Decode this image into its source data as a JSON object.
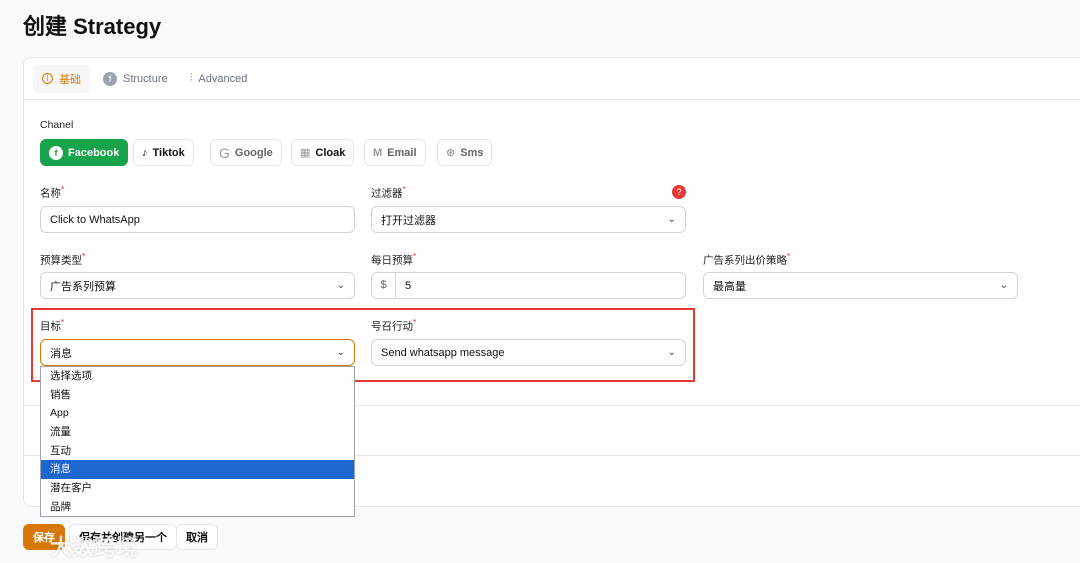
{
  "page_title": "创建 Strategy",
  "tabs": [
    {
      "label": "基础"
    },
    {
      "label": "Structure"
    },
    {
      "label": "Advanced"
    }
  ],
  "channel": {
    "label": "Chanel",
    "options": [
      "Facebook",
      "Tiktok",
      "Google",
      "Cloak",
      "Email",
      "Sms"
    ],
    "selected": "Facebook"
  },
  "form": {
    "name": {
      "label": "名称",
      "value": "Click to WhatsApp"
    },
    "filter": {
      "label": "过滤器",
      "value": "打开过滤器",
      "help": "?"
    },
    "budget_type": {
      "label": "预算类型",
      "value": "广告系列预算"
    },
    "daily_budget": {
      "label": "每日预算",
      "prefix": "$",
      "value": "5"
    },
    "bid_strategy": {
      "label": "广告系列出价策略",
      "value": "最高量"
    },
    "objective": {
      "label": "目标",
      "value": "消息",
      "options": [
        "选择选项",
        "销售",
        "App",
        "流量",
        "互动",
        "消息",
        "潜在客户",
        "品牌"
      ]
    },
    "cta": {
      "label": "号召行动",
      "value": "Send whatsapp message"
    }
  },
  "buttons": {
    "save": "保存",
    "save_create": "保存并创建另一个",
    "cancel": "取消"
  },
  "watermark": "大数跨境",
  "colors": {
    "accent": "#d97706",
    "facebook_green": "#16a34a",
    "highlight": "#e53935"
  }
}
